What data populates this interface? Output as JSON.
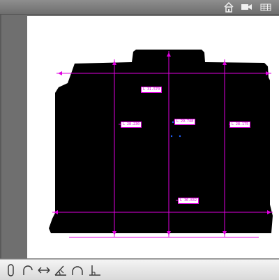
{
  "toolbar": {
    "icons": [
      "home-icon",
      "video-icon",
      "grid-view-icon"
    ]
  },
  "measurements": {
    "top_height": "L  31.570",
    "left_height": "L  28.230",
    "center_height": "L  29.748",
    "right_height": "L  28.175",
    "bottom_width": "L  36.832"
  },
  "tools": [
    "contour-tool-icon",
    "arc-tool-icon",
    "distance-tool-icon",
    "angle-tool-icon",
    "circle-tool-icon",
    "perpendicular-tool-icon"
  ],
  "colors": {
    "measure": "#e000e0",
    "part": "#000000",
    "background": "#ffffff",
    "frame": "#6f6f6f"
  }
}
